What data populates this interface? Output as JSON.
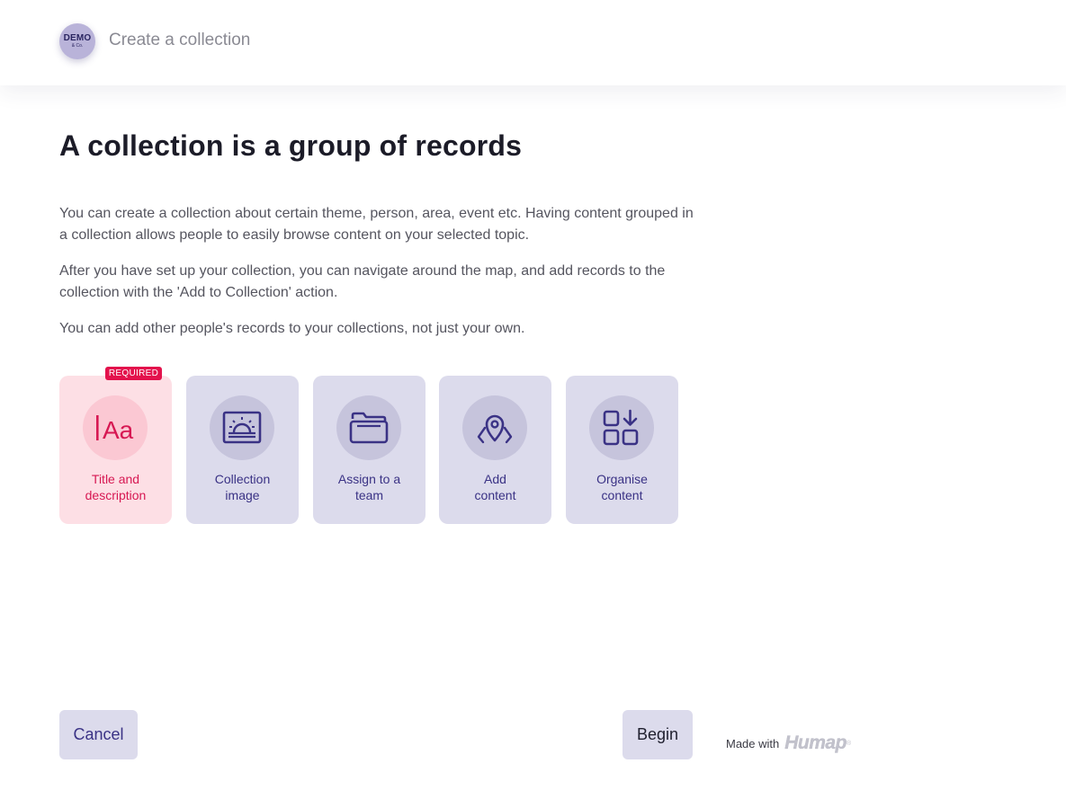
{
  "header": {
    "logo_main": "DEMO",
    "logo_sub": "& Co.",
    "title": "Create a collection"
  },
  "main": {
    "heading": "A collection is a group of records",
    "paragraphs": [
      "You can create a collection about certain theme, person, area, event etc. Having content grouped in a collection allows people to easily browse content on your selected topic.",
      "After you have set up your collection, you can navigate around the map, and add records to the collection with the 'Add to Collection' action.",
      "You can add other people's records to your collections, not just your own."
    ]
  },
  "steps": [
    {
      "label_line1": "Title and",
      "label_line2": "description",
      "icon": "text-font-icon",
      "required": true
    },
    {
      "label_line1": "Collection",
      "label_line2": "image",
      "icon": "sunrise-image-icon",
      "required": false
    },
    {
      "label_line1": "Assign to a",
      "label_line2": "team",
      "icon": "folder-icon",
      "required": false
    },
    {
      "label_line1": "Add",
      "label_line2": "content",
      "icon": "map-pin-icon",
      "required": false
    },
    {
      "label_line1": "Organise",
      "label_line2": "content",
      "icon": "grid-sort-icon",
      "required": false
    }
  ],
  "badge": "REQUIRED",
  "footer": {
    "cancel_label": "Cancel",
    "begin_label": "Begin",
    "made_with": "Made with",
    "brand": "Humap",
    "brand_mark": "®"
  },
  "colors": {
    "accent": "#3a3285",
    "required": "#e3124c",
    "card_bg": "#dcdbec",
    "required_card_bg": "#fddfe5"
  }
}
